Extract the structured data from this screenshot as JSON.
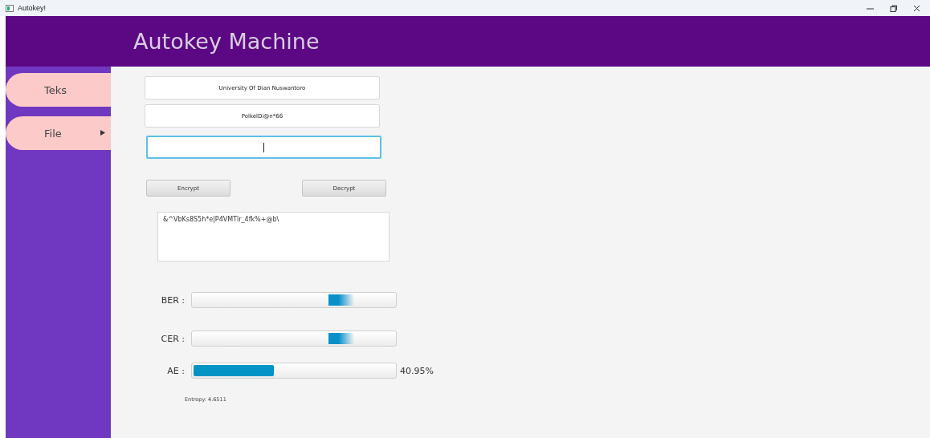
{
  "window": {
    "title": "Autokey!"
  },
  "header": {
    "title": "Autokey Machine"
  },
  "sidebar": {
    "items": [
      {
        "label": "Teks",
        "has_submenu": false
      },
      {
        "label": "File",
        "has_submenu": true
      }
    ]
  },
  "form": {
    "fields": [
      {
        "value": "University Of Dian Nuswantoro",
        "focused": false
      },
      {
        "value": "PolkelDi@n*66",
        "focused": false
      },
      {
        "focused": true
      }
    ],
    "buttons": [
      "Encrypt",
      "Decrypt"
    ],
    "output": "&^VbKs8S5h*e|P4VMTlr_4fk%+@b\\"
  },
  "meters": [
    {
      "label": "BER :",
      "kind": "indeterminate"
    },
    {
      "label": "CER :",
      "kind": "indeterminate"
    },
    {
      "label": "AE :",
      "kind": "determinate",
      "level": 0.4,
      "reading": "40.95%"
    }
  ],
  "entropy": "Entropy: 4.6511"
}
